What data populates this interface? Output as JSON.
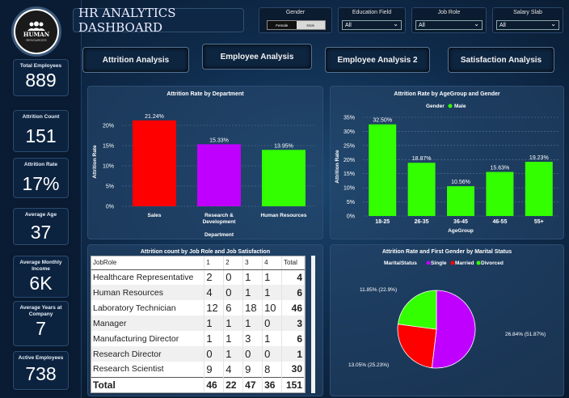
{
  "dashboard_title": "HR ANALYTICS DASHBOARD",
  "logo_text": {
    "line1": "HUMAN",
    "line2": "RESOURCES"
  },
  "kpis": [
    {
      "label": "Total Employees",
      "value": "889"
    },
    {
      "label": "Attrition Count",
      "value": "151"
    },
    {
      "label": "Attrition Rate",
      "value": "17%"
    },
    {
      "label": "Average Age",
      "value": "37"
    },
    {
      "label": "Average Monthly Income",
      "value": "6K"
    },
    {
      "label": "Average Years at Company",
      "value": "7"
    },
    {
      "label": "Active Employees",
      "value": "738"
    }
  ],
  "filters": {
    "gender": {
      "label": "Gender",
      "options": [
        "Female",
        "Male"
      ],
      "selected": "Female"
    },
    "education": {
      "label": "Education Field",
      "value": "All"
    },
    "job_role": {
      "label": "Job Role",
      "value": "All"
    },
    "salary": {
      "label": "Salary Slab",
      "value": "All"
    }
  },
  "nav": [
    "Attrition Analysis",
    "Employee Analysis",
    "Employee Analysis 2",
    "Satisfaction Analysis"
  ],
  "colors": {
    "red": "#ff0000",
    "purple": "#c000ff",
    "green": "#33ff00",
    "dark": "#0b1d35"
  },
  "chart_data": [
    {
      "type": "bar",
      "title": "Attrition Rate by Department",
      "ylabel": "Attrition Rate",
      "xlabel": "Department",
      "categories": [
        "Sales",
        "Research & Development",
        "Human Resources"
      ],
      "values": [
        21.24,
        15.33,
        13.95
      ],
      "data_labels": [
        "21.24%",
        "15.33%",
        "13.95%"
      ],
      "bar_colors": [
        "#ff0000",
        "#c000ff",
        "#33ff00"
      ],
      "yticks": [
        "0%",
        "5%",
        "10%",
        "15%",
        "20%"
      ],
      "ylim": [
        0,
        22
      ]
    },
    {
      "type": "bar",
      "title": "Attrition Rate by AgeGroup and Gender",
      "legend_title": "Gender",
      "legend_items": [
        "Male"
      ],
      "ylabel": "Attrition Rate",
      "xlabel": "AgeGroup",
      "categories": [
        "18-25",
        "26-35",
        "36-45",
        "46-55",
        "55+"
      ],
      "values": [
        32.5,
        18.87,
        10.56,
        15.63,
        19.23
      ],
      "data_labels": [
        "32.50%",
        "18.87%",
        "10.56%",
        "15.63%",
        "19.23%"
      ],
      "yticks": [
        "0%",
        "5%",
        "10%",
        "15%",
        "20%",
        "25%",
        "30%",
        "35%"
      ],
      "ylim": [
        0,
        35
      ]
    },
    {
      "type": "table",
      "title": "Attrition count by Job Role and Job Satisfaction",
      "headers": [
        "JobRole",
        "1",
        "2",
        "3",
        "4",
        "Total"
      ],
      "rows": [
        [
          "Healthcare Representative",
          "2",
          "0",
          "1",
          "1",
          "4"
        ],
        [
          "Human Resources",
          "4",
          "0",
          "1",
          "1",
          "6"
        ],
        [
          "Laboratory Technician",
          "12",
          "6",
          "18",
          "10",
          "46"
        ],
        [
          "Manager",
          "1",
          "1",
          "1",
          "0",
          "3"
        ],
        [
          "Manufacturing Director",
          "1",
          "1",
          "3",
          "1",
          "6"
        ],
        [
          "Research Director",
          "0",
          "1",
          "0",
          "0",
          "1"
        ],
        [
          "Research Scientist",
          "9",
          "4",
          "9",
          "8",
          "30"
        ]
      ],
      "total_row": [
        "Total",
        "46",
        "22",
        "47",
        "36",
        "151"
      ]
    },
    {
      "type": "pie",
      "title": "Attrition Rate and First Gender by Marital Status",
      "legend_title": "MaritalStatus",
      "categories": [
        "Single",
        "Married",
        "Divorced"
      ],
      "values": [
        51.87,
        25.23,
        22.9
      ],
      "data_labels": [
        "26.84% (51.87%)",
        "13.05% (25.23%)",
        "11.85% (22.9%)"
      ],
      "colors": [
        "#c000ff",
        "#ff0000",
        "#33ff00"
      ]
    }
  ]
}
